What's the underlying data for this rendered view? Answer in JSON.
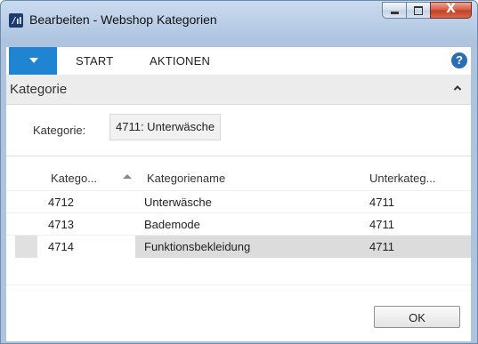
{
  "window": {
    "title": "Bearbeiten - Webshop Kategorien"
  },
  "caption": {
    "minimize": "–",
    "maximize": "□",
    "close": "X"
  },
  "ribbon": {
    "tabs": [
      {
        "label": "START"
      },
      {
        "label": "AKTIONEN"
      }
    ],
    "help": "?"
  },
  "section": {
    "title": "Kategorie"
  },
  "field": {
    "label": "Kategorie:",
    "value": "4711: Unterwäsche"
  },
  "table": {
    "headers": [
      "Katego...",
      "Kategoriename",
      "Unterkateg..."
    ],
    "sort_column": 0,
    "rows": [
      {
        "code": "4712",
        "name": "Unterwäsche",
        "parent": "4711"
      },
      {
        "code": "4713",
        "name": "Bademode",
        "parent": "4711"
      },
      {
        "code": "4714",
        "name": "Funktionsbekleidung",
        "parent": "4711",
        "selected": true
      }
    ]
  },
  "buttons": {
    "ok": "OK"
  },
  "colors": {
    "accent": "#1f84d1",
    "title_bar": "#b3c9e3",
    "selected_row": "#dcdcdc"
  }
}
